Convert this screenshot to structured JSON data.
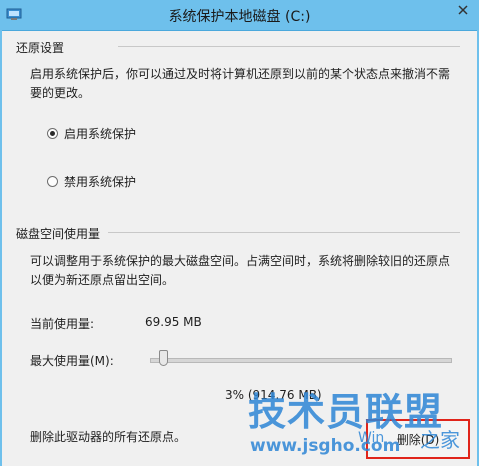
{
  "window": {
    "title": "系统保护本地磁盘 (C:)"
  },
  "restore_section": {
    "header": "还原设置",
    "description_line1": "启用系统保护后，你可以通过及时将计算机还原到以前的某个状态点来撤消不需",
    "description_line2": "要的更改。",
    "options": [
      {
        "label": "启用系统保护",
        "checked": true
      },
      {
        "label": "禁用系统保护",
        "checked": false
      }
    ]
  },
  "disk_section": {
    "header": "磁盘空间使用量",
    "description_line1": "可以调整用于系统保护的最大磁盘空间。占满空间时，系统将删除较旧的还原点",
    "description_line2": "以便为新还原点留出空间。",
    "current_usage_label": "当前使用量:",
    "current_usage_value": "69.95 MB",
    "max_usage_label": "最大使用量(M):",
    "slider_percent": 3,
    "max_usage_readout": "3% (914.76 MB)",
    "delete_description": "删除此驱动器的所有还原点。",
    "delete_button_label": "删除(D)"
  },
  "watermark": {
    "text": "技术员联盟",
    "url": "www.jsgho.com",
    "win": "Win",
    "home": "之家"
  },
  "colors": {
    "titlebar": "#6ec0ec",
    "highlight": "#e0241a",
    "watermark": "#2e86d6"
  }
}
